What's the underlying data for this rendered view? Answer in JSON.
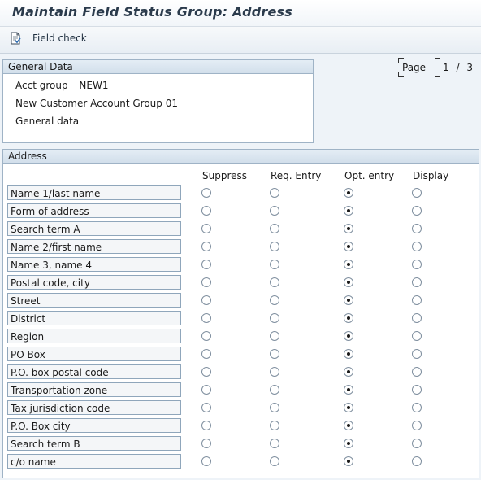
{
  "window": {
    "title": "Maintain Field Status Group: Address"
  },
  "toolbar": {
    "field_check_label": "Field check",
    "field_check_icon": "document-check-icon"
  },
  "general_data": {
    "heading": "General Data",
    "acct_group_label": "Acct group",
    "acct_group_value": "NEW1",
    "description": "New Customer Account Group 01",
    "group_name": "General data"
  },
  "pager": {
    "label": "Page",
    "current": "1",
    "separator": "/",
    "total": "3"
  },
  "address": {
    "heading": "Address",
    "columns": [
      "Suppress",
      "Req. Entry",
      "Opt. entry",
      "Display"
    ],
    "rows": [
      {
        "label": "Name 1/last name",
        "selected": "Opt. entry"
      },
      {
        "label": "Form of address",
        "selected": "Opt. entry"
      },
      {
        "label": "Search term A",
        "selected": "Opt. entry"
      },
      {
        "label": "Name 2/first name",
        "selected": "Opt. entry"
      },
      {
        "label": "Name 3, name 4",
        "selected": "Opt. entry"
      },
      {
        "label": "Postal code, city",
        "selected": "Opt. entry"
      },
      {
        "label": "Street",
        "selected": "Opt. entry"
      },
      {
        "label": "District",
        "selected": "Opt. entry"
      },
      {
        "label": "Region",
        "selected": "Opt. entry"
      },
      {
        "label": "PO Box",
        "selected": "Opt. entry"
      },
      {
        "label": "P.O. box postal code",
        "selected": "Opt. entry"
      },
      {
        "label": "Transportation zone",
        "selected": "Opt. entry"
      },
      {
        "label": "Tax jurisdiction code",
        "selected": "Opt. entry"
      },
      {
        "label": "P.O. Box city",
        "selected": "Opt. entry"
      },
      {
        "label": "Search term B",
        "selected": "Opt. entry"
      },
      {
        "label": "c/o name",
        "selected": "Opt. entry"
      }
    ]
  }
}
